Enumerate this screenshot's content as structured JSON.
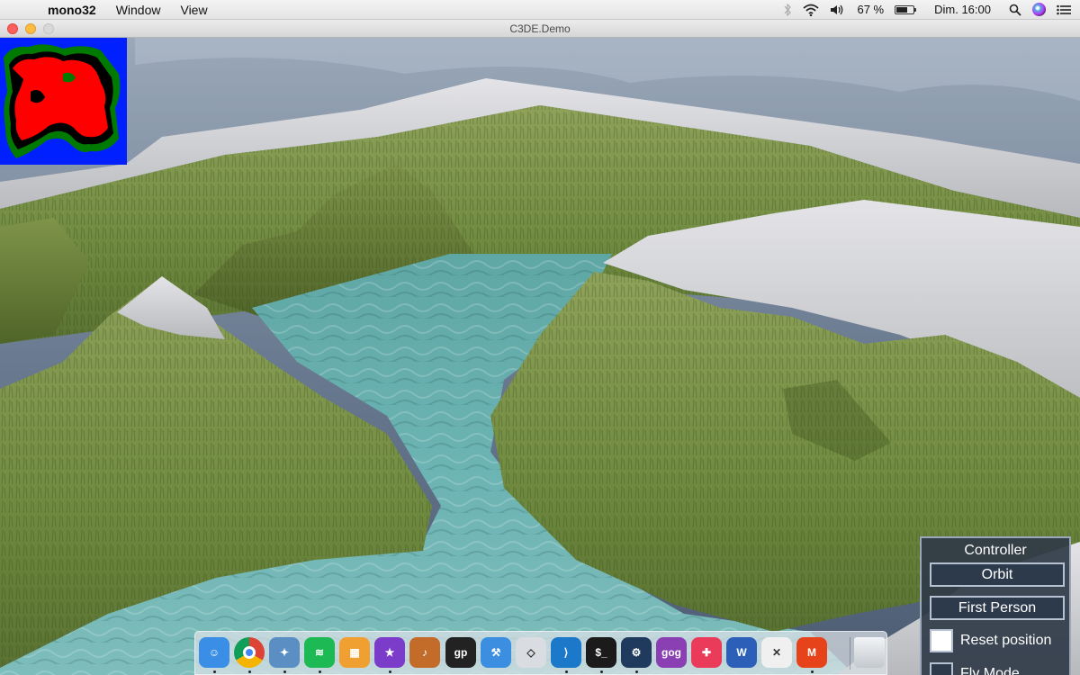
{
  "menubar": {
    "app_name": "mono32",
    "items": [
      {
        "label": "Window"
      },
      {
        "label": "View"
      }
    ],
    "battery_text": "67 %",
    "battery_level": 0.67,
    "clock": "Dim. 16:00"
  },
  "window": {
    "title": "C3DE.Demo"
  },
  "controller": {
    "title": "Controller",
    "buttons": [
      {
        "label": "Orbit"
      },
      {
        "label": "First Person"
      }
    ],
    "checkboxes": [
      {
        "label": "Reset position",
        "checked": true
      },
      {
        "label": "Fly Mode",
        "checked": false
      }
    ]
  },
  "dock": {
    "apps": [
      {
        "name": "finder-icon",
        "color": "#3a8ee6",
        "glyph": "☺"
      },
      {
        "name": "chrome-icon",
        "color": "#e8e8e8",
        "glyph": ""
      },
      {
        "name": "preview-icon",
        "color": "#5b8fc4",
        "glyph": "✦"
      },
      {
        "name": "spotify-icon",
        "color": "#1db954",
        "glyph": "≋"
      },
      {
        "name": "photos-icon",
        "color": "#f0a030",
        "glyph": "▦"
      },
      {
        "name": "imovie-icon",
        "color": "#7a3cc9",
        "glyph": "★"
      },
      {
        "name": "garageband-icon",
        "color": "#c36c2a",
        "glyph": "♪"
      },
      {
        "name": "guitar-pro-icon",
        "color": "#222222",
        "glyph": "gp"
      },
      {
        "name": "xcode-icon",
        "color": "#3c8fe0",
        "glyph": "⚒"
      },
      {
        "name": "unity-icon",
        "color": "#d9dde2",
        "glyph": "◇"
      },
      {
        "name": "vscode-icon",
        "color": "#1c78c9",
        "glyph": "⟩"
      },
      {
        "name": "terminal-icon",
        "color": "#1b1b1b",
        "glyph": "$_"
      },
      {
        "name": "steam-icon",
        "color": "#1f3a5c",
        "glyph": "⚙"
      },
      {
        "name": "gog-icon",
        "color": "#8a3fb3",
        "glyph": "gog"
      },
      {
        "name": "game-center-icon",
        "color": "#ea3b5b",
        "glyph": "✚"
      },
      {
        "name": "word-icon",
        "color": "#2b5fb8",
        "glyph": "W"
      },
      {
        "name": "xamarin-icon",
        "color": "#f0f0f0",
        "glyph": "✕"
      },
      {
        "name": "monogame-icon",
        "color": "#e7431a",
        "glyph": "M"
      },
      {
        "name": "trash-icon",
        "color": "#cfd4d9",
        "glyph": ""
      }
    ]
  }
}
